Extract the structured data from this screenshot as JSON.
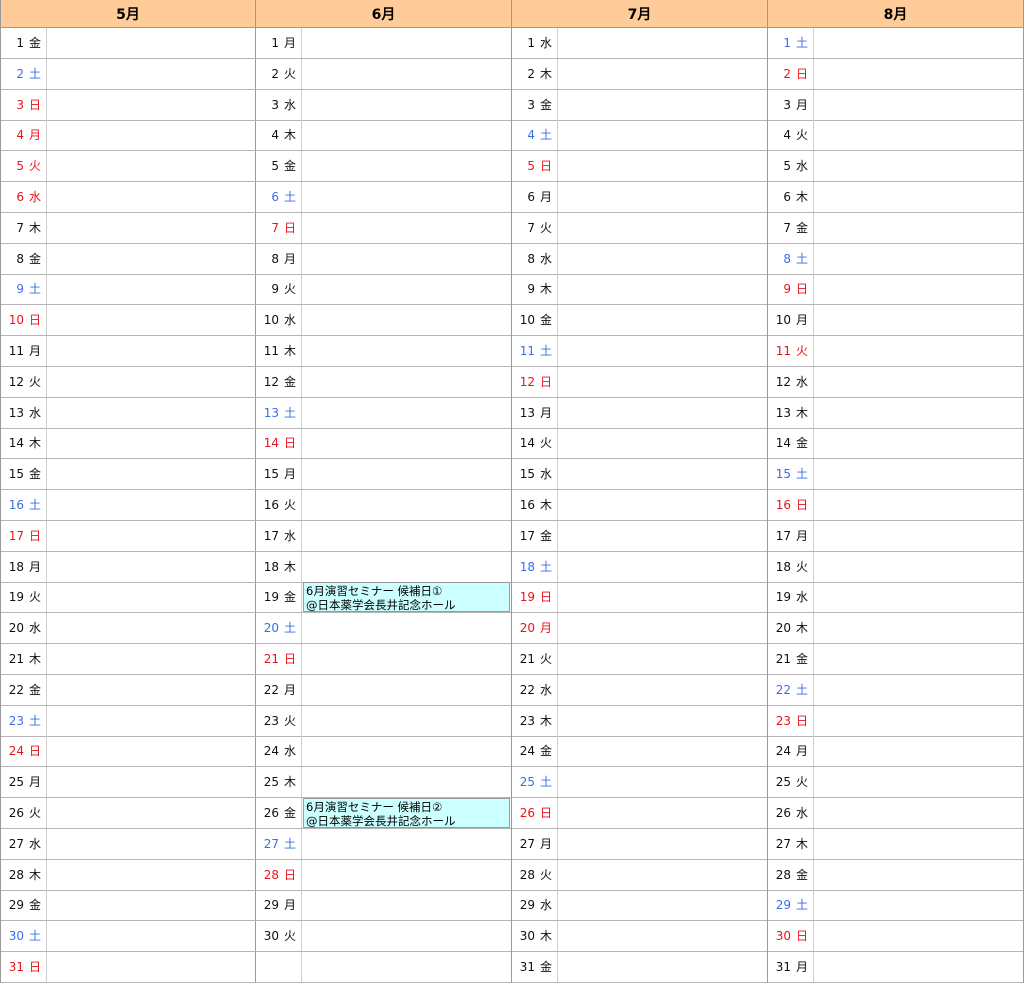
{
  "months": [
    {
      "name": "5月",
      "days": [
        {
          "d": "1",
          "w": "金",
          "t": "n"
        },
        {
          "d": "2",
          "w": "土",
          "t": "s"
        },
        {
          "d": "3",
          "w": "日",
          "t": "h"
        },
        {
          "d": "4",
          "w": "月",
          "t": "h"
        },
        {
          "d": "5",
          "w": "火",
          "t": "h"
        },
        {
          "d": "6",
          "w": "水",
          "t": "h"
        },
        {
          "d": "7",
          "w": "木",
          "t": "n"
        },
        {
          "d": "8",
          "w": "金",
          "t": "n"
        },
        {
          "d": "9",
          "w": "土",
          "t": "s"
        },
        {
          "d": "10",
          "w": "日",
          "t": "h"
        },
        {
          "d": "11",
          "w": "月",
          "t": "n"
        },
        {
          "d": "12",
          "w": "火",
          "t": "n"
        },
        {
          "d": "13",
          "w": "水",
          "t": "n"
        },
        {
          "d": "14",
          "w": "木",
          "t": "n"
        },
        {
          "d": "15",
          "w": "金",
          "t": "n"
        },
        {
          "d": "16",
          "w": "土",
          "t": "s"
        },
        {
          "d": "17",
          "w": "日",
          "t": "h"
        },
        {
          "d": "18",
          "w": "月",
          "t": "n"
        },
        {
          "d": "19",
          "w": "火",
          "t": "n"
        },
        {
          "d": "20",
          "w": "水",
          "t": "n"
        },
        {
          "d": "21",
          "w": "木",
          "t": "n"
        },
        {
          "d": "22",
          "w": "金",
          "t": "n"
        },
        {
          "d": "23",
          "w": "土",
          "t": "s"
        },
        {
          "d": "24",
          "w": "日",
          "t": "h"
        },
        {
          "d": "25",
          "w": "月",
          "t": "n"
        },
        {
          "d": "26",
          "w": "火",
          "t": "n"
        },
        {
          "d": "27",
          "w": "水",
          "t": "n"
        },
        {
          "d": "28",
          "w": "木",
          "t": "n"
        },
        {
          "d": "29",
          "w": "金",
          "t": "n"
        },
        {
          "d": "30",
          "w": "土",
          "t": "s"
        },
        {
          "d": "31",
          "w": "日",
          "t": "h"
        }
      ]
    },
    {
      "name": "6月",
      "days": [
        {
          "d": "1",
          "w": "月",
          "t": "n"
        },
        {
          "d": "2",
          "w": "火",
          "t": "n"
        },
        {
          "d": "3",
          "w": "水",
          "t": "n"
        },
        {
          "d": "4",
          "w": "木",
          "t": "n"
        },
        {
          "d": "5",
          "w": "金",
          "t": "n"
        },
        {
          "d": "6",
          "w": "土",
          "t": "s"
        },
        {
          "d": "7",
          "w": "日",
          "t": "h"
        },
        {
          "d": "8",
          "w": "月",
          "t": "n"
        },
        {
          "d": "9",
          "w": "火",
          "t": "n"
        },
        {
          "d": "10",
          "w": "水",
          "t": "n"
        },
        {
          "d": "11",
          "w": "木",
          "t": "n"
        },
        {
          "d": "12",
          "w": "金",
          "t": "n"
        },
        {
          "d": "13",
          "w": "土",
          "t": "s"
        },
        {
          "d": "14",
          "w": "日",
          "t": "h"
        },
        {
          "d": "15",
          "w": "月",
          "t": "n"
        },
        {
          "d": "16",
          "w": "火",
          "t": "n"
        },
        {
          "d": "17",
          "w": "水",
          "t": "n"
        },
        {
          "d": "18",
          "w": "木",
          "t": "n"
        },
        {
          "d": "19",
          "w": "金",
          "t": "n",
          "event": [
            "6月演習セミナー 候補日①",
            "@日本薬学会長井記念ホール"
          ]
        },
        {
          "d": "20",
          "w": "土",
          "t": "s"
        },
        {
          "d": "21",
          "w": "日",
          "t": "h"
        },
        {
          "d": "22",
          "w": "月",
          "t": "n"
        },
        {
          "d": "23",
          "w": "火",
          "t": "n"
        },
        {
          "d": "24",
          "w": "水",
          "t": "n"
        },
        {
          "d": "25",
          "w": "木",
          "t": "n"
        },
        {
          "d": "26",
          "w": "金",
          "t": "n",
          "event": [
            "6月演習セミナー 候補日②",
            "@日本薬学会長井記念ホール"
          ]
        },
        {
          "d": "27",
          "w": "土",
          "t": "s"
        },
        {
          "d": "28",
          "w": "日",
          "t": "h"
        },
        {
          "d": "29",
          "w": "月",
          "t": "n"
        },
        {
          "d": "30",
          "w": "火",
          "t": "n"
        }
      ]
    },
    {
      "name": "7月",
      "days": [
        {
          "d": "1",
          "w": "水",
          "t": "n"
        },
        {
          "d": "2",
          "w": "木",
          "t": "n"
        },
        {
          "d": "3",
          "w": "金",
          "t": "n"
        },
        {
          "d": "4",
          "w": "土",
          "t": "s"
        },
        {
          "d": "5",
          "w": "日",
          "t": "h"
        },
        {
          "d": "6",
          "w": "月",
          "t": "n"
        },
        {
          "d": "7",
          "w": "火",
          "t": "n"
        },
        {
          "d": "8",
          "w": "水",
          "t": "n"
        },
        {
          "d": "9",
          "w": "木",
          "t": "n"
        },
        {
          "d": "10",
          "w": "金",
          "t": "n"
        },
        {
          "d": "11",
          "w": "土",
          "t": "s"
        },
        {
          "d": "12",
          "w": "日",
          "t": "h"
        },
        {
          "d": "13",
          "w": "月",
          "t": "n"
        },
        {
          "d": "14",
          "w": "火",
          "t": "n"
        },
        {
          "d": "15",
          "w": "水",
          "t": "n"
        },
        {
          "d": "16",
          "w": "木",
          "t": "n"
        },
        {
          "d": "17",
          "w": "金",
          "t": "n"
        },
        {
          "d": "18",
          "w": "土",
          "t": "s"
        },
        {
          "d": "19",
          "w": "日",
          "t": "h"
        },
        {
          "d": "20",
          "w": "月",
          "t": "h"
        },
        {
          "d": "21",
          "w": "火",
          "t": "n"
        },
        {
          "d": "22",
          "w": "水",
          "t": "n"
        },
        {
          "d": "23",
          "w": "木",
          "t": "n"
        },
        {
          "d": "24",
          "w": "金",
          "t": "n"
        },
        {
          "d": "25",
          "w": "土",
          "t": "s"
        },
        {
          "d": "26",
          "w": "日",
          "t": "h"
        },
        {
          "d": "27",
          "w": "月",
          "t": "n"
        },
        {
          "d": "28",
          "w": "火",
          "t": "n"
        },
        {
          "d": "29",
          "w": "水",
          "t": "n"
        },
        {
          "d": "30",
          "w": "木",
          "t": "n"
        },
        {
          "d": "31",
          "w": "金",
          "t": "n"
        }
      ]
    },
    {
      "name": "8月",
      "days": [
        {
          "d": "1",
          "w": "土",
          "t": "s"
        },
        {
          "d": "2",
          "w": "日",
          "t": "h"
        },
        {
          "d": "3",
          "w": "月",
          "t": "n"
        },
        {
          "d": "4",
          "w": "火",
          "t": "n"
        },
        {
          "d": "5",
          "w": "水",
          "t": "n"
        },
        {
          "d": "6",
          "w": "木",
          "t": "n"
        },
        {
          "d": "7",
          "w": "金",
          "t": "n"
        },
        {
          "d": "8",
          "w": "土",
          "t": "s"
        },
        {
          "d": "9",
          "w": "日",
          "t": "h"
        },
        {
          "d": "10",
          "w": "月",
          "t": "n"
        },
        {
          "d": "11",
          "w": "火",
          "t": "h"
        },
        {
          "d": "12",
          "w": "水",
          "t": "n"
        },
        {
          "d": "13",
          "w": "木",
          "t": "n"
        },
        {
          "d": "14",
          "w": "金",
          "t": "n"
        },
        {
          "d": "15",
          "w": "土",
          "t": "s"
        },
        {
          "d": "16",
          "w": "日",
          "t": "h"
        },
        {
          "d": "17",
          "w": "月",
          "t": "n"
        },
        {
          "d": "18",
          "w": "火",
          "t": "n"
        },
        {
          "d": "19",
          "w": "水",
          "t": "n"
        },
        {
          "d": "20",
          "w": "木",
          "t": "n"
        },
        {
          "d": "21",
          "w": "金",
          "t": "n"
        },
        {
          "d": "22",
          "w": "土",
          "t": "s"
        },
        {
          "d": "23",
          "w": "日",
          "t": "h"
        },
        {
          "d": "24",
          "w": "月",
          "t": "n"
        },
        {
          "d": "25",
          "w": "火",
          "t": "n"
        },
        {
          "d": "26",
          "w": "水",
          "t": "n"
        },
        {
          "d": "27",
          "w": "木",
          "t": "n"
        },
        {
          "d": "28",
          "w": "金",
          "t": "n"
        },
        {
          "d": "29",
          "w": "土",
          "t": "s"
        },
        {
          "d": "30",
          "w": "日",
          "t": "h"
        },
        {
          "d": "31",
          "w": "月",
          "t": "n"
        }
      ]
    }
  ],
  "colors": {
    "header_bg": "#ffcc99",
    "saturday": "#3a6ee8",
    "holiday": "#e8141e",
    "event_bg": "#ccffff"
  }
}
